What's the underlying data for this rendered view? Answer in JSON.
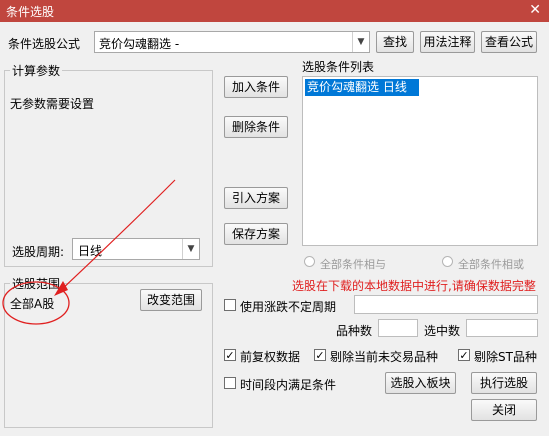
{
  "window": {
    "title": "条件选股",
    "close": "✕"
  },
  "formula": {
    "label": "条件选股公式",
    "value": "竞价勾魂翻选 -"
  },
  "buttons": {
    "find": "查找",
    "usage": "用法注释",
    "view": "查看公式",
    "add": "加入条件",
    "delete": "删除条件",
    "import": "引入方案",
    "save": "保存方案",
    "change_range": "改变范围",
    "to_block": "选股入板块",
    "execute": "执行选股",
    "close": "关闭"
  },
  "params": {
    "legend": "计算参数",
    "text": "无参数需要设置",
    "period_label": "选股周期:",
    "period_value": "日线"
  },
  "conditions": {
    "title": "选股条件列表",
    "items": [
      "竞价勾魂翻选  日线"
    ]
  },
  "radios": {
    "and": "全部条件相与",
    "or": "全部条件相或"
  },
  "range": {
    "legend": "选股范围",
    "value": "全部A股"
  },
  "notice": "选股在下载的本地数据中进行,请确保数据完整",
  "options": {
    "irregular": "使用涨跌不定周期",
    "count_label": "品种数",
    "selected_label": "选中数",
    "fq": "前复权数据",
    "no_trade": "剔除当前未交易品种",
    "no_st": "剔除ST品种",
    "time_range": "时间段内满足条件"
  },
  "colors": {
    "titlebar": "#c0463e",
    "selection": "#0078d7",
    "notice": "#e01f1f",
    "annotation": "#e02020"
  }
}
